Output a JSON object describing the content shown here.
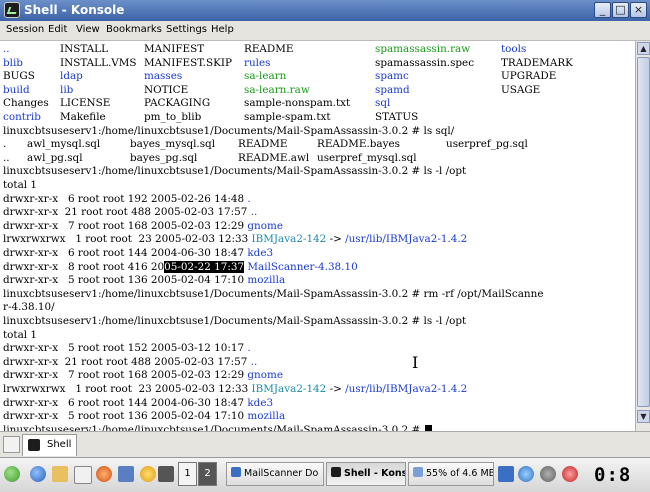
{
  "window": {
    "title": "Shell - Konsole",
    "buttons": [
      "_",
      "□",
      "×"
    ]
  },
  "menu": [
    "Session",
    "Edit",
    "View",
    "Bookmarks",
    "Settings",
    "Help"
  ],
  "colors": {
    "directory": "#1a3ad6",
    "executable": "#1a9a1a",
    "symlink": "#1a8aa8",
    "titlebar": "#3c63a8"
  },
  "terminal": {
    "lines": [
      [
        {
          "t": "..",
          "c": "blue"
        },
        {
          "t": "INSTALL"
        },
        {
          "t": "MANIFEST"
        },
        {
          "t": "README"
        },
        {
          "t": "spamassassin.raw",
          "c": "green"
        },
        {
          "t": "tools",
          "c": "blue"
        }
      ],
      [
        {
          "t": "blib",
          "c": "blue"
        },
        {
          "t": "INSTALL.VMS"
        },
        {
          "t": "MANIFEST.SKIP"
        },
        {
          "t": "rules",
          "c": "blue"
        },
        {
          "t": "spamassassin.spec"
        },
        {
          "t": "TRADEMARK"
        }
      ],
      [
        {
          "t": "BUGS"
        },
        {
          "t": "ldap",
          "c": "blue"
        },
        {
          "t": "masses",
          "c": "blue"
        },
        {
          "t": "sa-learn",
          "c": "green"
        },
        {
          "t": "spamc",
          "c": "blue"
        },
        {
          "t": "UPGRADE"
        }
      ],
      [
        {
          "t": "build",
          "c": "blue"
        },
        {
          "t": "lib",
          "c": "blue"
        },
        {
          "t": "NOTICE"
        },
        {
          "t": "sa-learn.raw",
          "c": "green"
        },
        {
          "t": "spamd",
          "c": "blue"
        },
        {
          "t": "USAGE"
        }
      ],
      [
        {
          "t": "Changes"
        },
        {
          "t": "LICENSE"
        },
        {
          "t": "PACKAGING"
        },
        {
          "t": "sample-nonspam.txt"
        },
        {
          "t": "sql",
          "c": "blue"
        }
      ],
      [
        {
          "t": "contrib",
          "c": "blue"
        },
        {
          "t": "Makefile"
        },
        {
          "t": "pm_to_blib"
        },
        {
          "t": "sample-spam.txt"
        },
        {
          "t": "STATUS"
        }
      ],
      [
        {
          "t": "linuxcbtsuseserv1:/home/linuxcbtsuse1/Documents/Mail-SpamAssassin-3.0.2 # ls sql/"
        }
      ],
      [
        {
          "t": "."
        },
        {
          "t": "awl_mysql.sql"
        },
        {
          "t": "bayes_mysql.sql"
        },
        {
          "t": "README"
        },
        {
          "t": "README.bayes"
        },
        {
          "t": "userpref_pg.sql"
        }
      ],
      [
        {
          "t": ".."
        },
        {
          "t": "awl_pg.sql"
        },
        {
          "t": "bayes_pg.sql"
        },
        {
          "t": "README.awl"
        },
        {
          "t": "userpref_mysql.sql"
        }
      ],
      [
        {
          "t": "linuxcbtsuseserv1:/home/linuxcbtsuse1/Documents/Mail-SpamAssassin-3.0.2 # ls -l /opt"
        }
      ],
      [
        {
          "t": "total 1"
        }
      ],
      [
        {
          "t": "drwxr-xr-x   6 root root 192 2005-02-26 14:48 "
        },
        {
          "t": ".",
          "c": "blue"
        }
      ],
      [
        {
          "t": "drwxr-xr-x  21 root root 488 2005-02-03 17:57 "
        },
        {
          "t": "..",
          "c": "blue"
        }
      ],
      [
        {
          "t": "drwxr-xr-x   7 root root 168 2005-02-03 12:29 "
        },
        {
          "t": "gnome",
          "c": "blue"
        }
      ],
      [
        {
          "t": "lrwxrwxrwx   1 root root  23 2005-02-03 12:33 "
        },
        {
          "t": "IBMJava2-142",
          "c": "cyan"
        },
        {
          "t": " -> "
        },
        {
          "t": "/usr/lib/IBMJava2-1.4.2",
          "c": "blue"
        }
      ],
      [
        {
          "t": "drwxr-xr-x   6 root root 144 2004-06-30 18:47 "
        },
        {
          "t": "kde3",
          "c": "blue"
        }
      ],
      [
        {
          "t": "drwxr-xr-x   8 root root 416 20"
        },
        {
          "t": "05-02-22 17:37",
          "c": "hl"
        },
        {
          "t": " "
        },
        {
          "t": "MailScanner-4.38.10",
          "c": "blue"
        }
      ],
      [
        {
          "t": "drwxr-xr-x   5 root root 136 2005-02-04 17:10 "
        },
        {
          "t": "mozilla",
          "c": "blue"
        }
      ],
      [
        {
          "t": "linuxcbtsuseserv1:/home/linuxcbtsuse1/Documents/Mail-SpamAssassin-3.0.2 # rm -rf /opt/MailScanne"
        }
      ],
      [
        {
          "t": "r-4.38.10/"
        }
      ],
      [
        {
          "t": "linuxcbtsuseserv1:/home/linuxcbtsuse1/Documents/Mail-SpamAssassin-3.0.2 # ls -l /opt"
        }
      ],
      [
        {
          "t": "total 1"
        }
      ],
      [
        {
          "t": "drwxr-xr-x   5 root root 152 2005-03-12 10:17 "
        },
        {
          "t": ".",
          "c": "blue"
        }
      ],
      [
        {
          "t": "drwxr-xr-x  21 root root 488 2005-02-03 17:57 "
        },
        {
          "t": "..",
          "c": "blue"
        }
      ],
      [
        {
          "t": "drwxr-xr-x   7 root root 168 2005-02-03 12:29 "
        },
        {
          "t": "gnome",
          "c": "blue"
        }
      ],
      [
        {
          "t": "lrwxrwxrwx   1 root root  23 2005-02-03 12:33 "
        },
        {
          "t": "IBMJava2-142",
          "c": "cyan"
        },
        {
          "t": " -> "
        },
        {
          "t": "/usr/lib/IBMJava2-1.4.2",
          "c": "blue"
        }
      ],
      [
        {
          "t": "drwxr-xr-x   6 root root 144 2004-06-30 18:47 "
        },
        {
          "t": "kde3",
          "c": "blue"
        }
      ],
      [
        {
          "t": "drwxr-xr-x   5 root root 136 2005-02-04 17:10 "
        },
        {
          "t": "mozilla",
          "c": "blue"
        }
      ],
      [
        {
          "t": "linuxcbtsuseserv1:/home/linuxcbtsuse1/Documents/Mail-SpamAssassin-3.0.2 # "
        }
      ]
    ]
  },
  "session_tab": {
    "label": "Shell"
  },
  "taskbar": {
    "pager": [
      "1",
      "2"
    ],
    "tasks": [
      {
        "label": "MailScanner Do",
        "icon_color": "#3a6fc4"
      },
      {
        "label": "Shell - Konsole",
        "icon_color": "#1d1d1d"
      },
      {
        "label": "55% of 4.6 MB",
        "icon_color": "#7aa0d8"
      }
    ],
    "clock": "0:8",
    "tray_icons": [
      "suse-chameleon-icon",
      "globe-icon",
      "home-folder-icon",
      "mail-icon",
      "network-icon",
      "monitor-icon",
      "lightning-icon",
      "speaker-icon",
      "konqueror-icon",
      "shield-icon"
    ]
  }
}
